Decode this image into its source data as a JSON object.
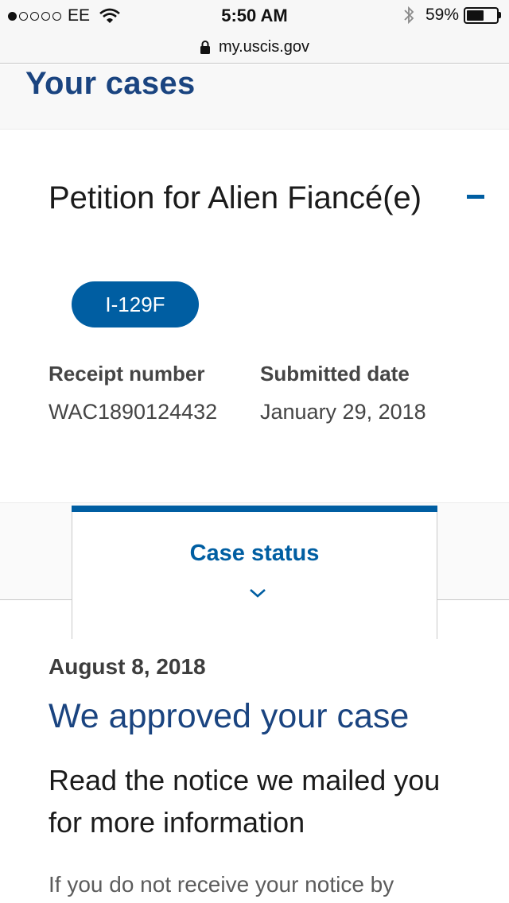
{
  "status_bar": {
    "carrier": "EE",
    "time": "5:50 AM",
    "battery": "59%",
    "battery_level": 0.59,
    "signal_bars_filled": 1,
    "signal_bars_total": 5,
    "icons": [
      "wifi-icon",
      "bluetooth-icon",
      "battery-icon",
      "lock-icon"
    ]
  },
  "browser": {
    "url": "my.uscis.gov"
  },
  "page": {
    "title": "Your cases"
  },
  "case": {
    "title": "Petition for Alien Fiancé(e)",
    "form_type": "I-129F",
    "receipt_label": "Receipt number",
    "receipt_number": "WAC1890124432",
    "submitted_label": "Submitted date",
    "submitted_date": "January 29, 2018",
    "collapse_icon": "minus-icon"
  },
  "status": {
    "tab_label": "Case status",
    "chevron_icon": "chevron-down-icon",
    "date": "August 8, 2018",
    "heading": "We approved your case",
    "notice": "Read the notice we mailed you for more information",
    "more_text": "If you do not receive your notice by"
  },
  "colors": {
    "primary_blue": "#005ea2",
    "heading_blue": "#1a4480",
    "text": "#1b1b1b",
    "muted_text": "#454545"
  }
}
